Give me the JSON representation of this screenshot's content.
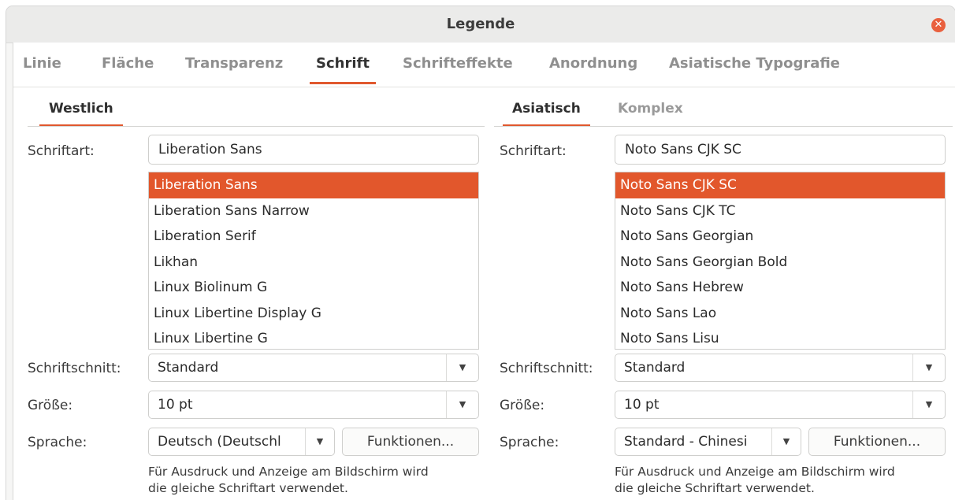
{
  "window": {
    "title": "Legende",
    "close_icon": "close-icon",
    "accent_color": "#e0582e"
  },
  "main_tabs": [
    {
      "label": "Linie",
      "active": false
    },
    {
      "label": "Fläche",
      "active": false
    },
    {
      "label": "Transparenz",
      "active": false
    },
    {
      "label": "Schrift",
      "active": true
    },
    {
      "label": "Schrifteffekte",
      "active": false
    },
    {
      "label": "Anordnung",
      "active": false
    },
    {
      "label": "Asiatische Typografie",
      "active": false
    }
  ],
  "western": {
    "tab_label": "Westlich",
    "font_label": "Schriftart:",
    "font_value": "Liberation Sans",
    "font_list": [
      "Liberation Sans",
      "Liberation Sans Narrow",
      "Liberation Serif",
      "Likhan",
      "Linux Biolinum G",
      "Linux Libertine Display G",
      "Linux Libertine G"
    ],
    "selected_index": 0,
    "style_label": "Schriftschnitt:",
    "style_value": "Standard",
    "size_label": "Größe:",
    "size_value": "10 pt",
    "language_label": "Sprache:",
    "language_value": "Deutsch (Deutschl",
    "features_button": "Funktionen...",
    "note_line1": "Für Ausdruck und Anzeige am Bildschirm wird",
    "note_line2": "die gleiche Schriftart verwendet."
  },
  "asian": {
    "tab_label": "Asiatisch",
    "complex_tab_label": "Komplex",
    "font_label": "Schriftart:",
    "font_value": "Noto Sans CJK SC",
    "font_list": [
      "Noto Sans CJK SC",
      "Noto Sans CJK TC",
      "Noto Sans Georgian",
      "Noto Sans Georgian Bold",
      "Noto Sans Hebrew",
      "Noto Sans Lao",
      "Noto Sans Lisu"
    ],
    "selected_index": 0,
    "style_label": "Schriftschnitt:",
    "style_value": "Standard",
    "size_label": "Größe:",
    "size_value": "10 pt",
    "language_label": "Sprache:",
    "language_value": "Standard - Chinesi",
    "features_button": "Funktionen...",
    "note_line1": "Für Ausdruck und Anzeige am Bildschirm wird",
    "note_line2": "die gleiche Schriftart verwendet."
  },
  "icons": {
    "dropdown": "chevron-down-icon"
  }
}
